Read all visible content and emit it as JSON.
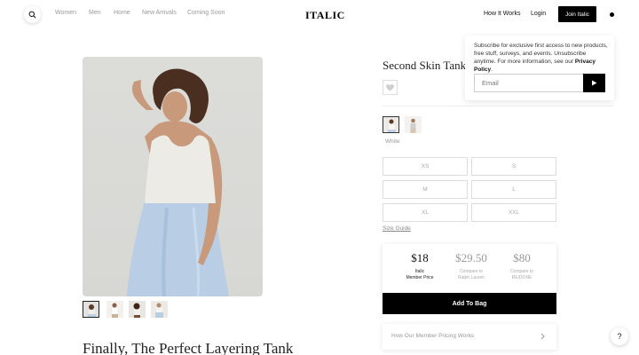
{
  "header": {
    "search_icon": "search-icon",
    "nav": [
      "Women",
      "Men",
      "Home",
      "New Arrivals",
      "Coming Soon"
    ],
    "logo": "ITALIC",
    "how_it_works": "How It Works",
    "login": "Login",
    "join": "Join Italic",
    "cart_icon": "cart-dot-icon"
  },
  "product": {
    "title": "Second Skin Tank",
    "wishlist_icon": "heart-icon",
    "color_label": "White",
    "sizes": [
      "XS",
      "S",
      "M",
      "L",
      "XL",
      "XXL"
    ],
    "size_guide": "Size Guide",
    "prices": [
      {
        "value": "$18",
        "line1": "Italic",
        "line2": "Member Price"
      },
      {
        "value": "$29.50",
        "line1": "Compare to",
        "line2": "Ralph Lauren"
      },
      {
        "value": "$80",
        "line1": "Compare to",
        "line2": "RE/DONE"
      }
    ],
    "add_to_bag": "Add To Bag",
    "pricing_link": "How Our Member Pricing Works"
  },
  "gallery": {
    "heading": "Finally, The Perfect Layering Tank"
  },
  "popup": {
    "text": "Subscribe for exclusive first access to new products, free stuff, surveys, and events. Unsubscribe anytime. For more information, see our",
    "link": "Privacy Policy",
    "period": ".",
    "email_placeholder": "Email"
  },
  "help": "?",
  "colors": {
    "accent": "#000000",
    "muted": "#999999",
    "border": "#dcdcdc"
  }
}
